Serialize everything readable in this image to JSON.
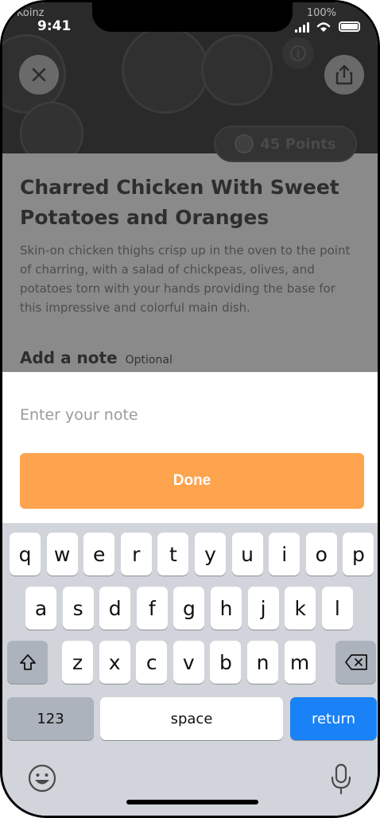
{
  "status_bar": {
    "carrier": "Koinz",
    "time": "9:41",
    "battery": "100%"
  },
  "recipe": {
    "points_label": "45 Points",
    "title": "Charred Chicken With Sweet Potatoes and Oranges",
    "description": "Skin-on chicken thighs crisp up in the oven to the point of charring, with a salad of chickpeas, olives, and potatoes torn with your hands providing the base for this impressive and colorful main dish."
  },
  "note": {
    "heading": "Add a note",
    "optional_label": "Optional",
    "placeholder": "Enter your note",
    "value": "",
    "done_label": "Done"
  },
  "keyboard": {
    "row1": [
      "q",
      "w",
      "e",
      "r",
      "t",
      "y",
      "u",
      "i",
      "o",
      "p"
    ],
    "row2": [
      "a",
      "s",
      "d",
      "f",
      "g",
      "h",
      "j",
      "k",
      "l"
    ],
    "row3": [
      "z",
      "x",
      "c",
      "v",
      "b",
      "n",
      "m"
    ],
    "numbers_label": "123",
    "space_label": "space",
    "return_label": "return"
  },
  "colors": {
    "accent": "#fea44f",
    "return_key": "#1a82f7"
  },
  "icons": [
    "close-icon",
    "share-icon",
    "info-icon",
    "coin-icon",
    "shift-icon",
    "backspace-icon",
    "emoji-icon",
    "microphone-icon"
  ]
}
